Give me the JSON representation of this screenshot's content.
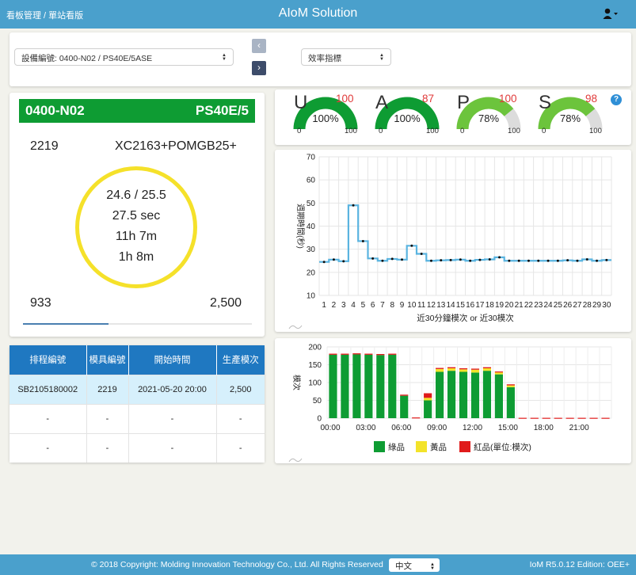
{
  "header": {
    "breadcrumb": "看板管理 / 單站看版",
    "title": "AIoM Solution",
    "user_icon": "user-icon"
  },
  "filters": {
    "device_select": "設備編號: 0400-N02 / PS40E/5ASE",
    "metric_select": "效率指標",
    "prev_icon": "chevron-left-icon",
    "next_icon": "chevron-right-icon"
  },
  "machine": {
    "id": "0400-N02",
    "model": "PS40E/5",
    "mold": "2219",
    "product": "XC2163+POMGB25+",
    "cycle_ratio": "24.6 / 25.5",
    "cycle_time": "27.5 sec",
    "run_time": "11h 7m",
    "remaining_time": "1h 8m",
    "count_done": "933",
    "count_target": "2,500",
    "progress": 0.373
  },
  "schedule": {
    "headers": [
      "排程編號",
      "模具編號",
      "開始時間",
      "生產模次"
    ],
    "rows": [
      [
        "SB2105180002",
        "2219",
        "2021-05-20 20:00",
        "2,500"
      ],
      [
        "-",
        "-",
        "-",
        "-"
      ],
      [
        "-",
        "-",
        "-",
        "-"
      ]
    ]
  },
  "gauges": [
    {
      "letter": "U",
      "target": "100",
      "value": "100%",
      "fraction": 1.0,
      "min": "0",
      "max": "100",
      "color": "#0e9c33"
    },
    {
      "letter": "A",
      "target": "87",
      "value": "100%",
      "fraction": 1.0,
      "min": "0",
      "max": "100",
      "color": "#0e9c33"
    },
    {
      "letter": "P",
      "target": "100",
      "value": "78%",
      "fraction": 0.78,
      "min": "0",
      "max": "100",
      "color": "#6cc43c"
    },
    {
      "letter": "S",
      "target": "98",
      "value": "78%",
      "fraction": 0.78,
      "min": "0",
      "max": "100",
      "color": "#6cc43c"
    }
  ],
  "help_icon": "?",
  "chart_data": [
    {
      "type": "line",
      "ylabel": "週期時間(秒)",
      "xlabel": "近30分鐘模次 or 近30模次",
      "ylim": [
        10,
        70
      ],
      "yticks": [
        "10",
        "20",
        "30",
        "40",
        "50",
        "60",
        "70"
      ],
      "x": [
        "1",
        "2",
        "3",
        "4",
        "5",
        "6",
        "7",
        "8",
        "9",
        "10",
        "11",
        "12",
        "13",
        "14",
        "15",
        "16",
        "17",
        "18",
        "19",
        "20",
        "21",
        "22",
        "23",
        "24",
        "25",
        "26",
        "27",
        "28",
        "29",
        "30"
      ],
      "values": [
        24.5,
        25.5,
        24.8,
        49,
        33.5,
        26,
        25,
        25.8,
        25.5,
        31.5,
        28,
        25,
        25.2,
        25.3,
        25.5,
        25,
        25.4,
        25.6,
        26.5,
        25,
        25,
        25,
        25,
        25,
        25,
        25.2,
        25,
        25.6,
        25,
        25.3
      ],
      "color": "#5ab4e0",
      "grid": true
    },
    {
      "type": "bar",
      "stacked": true,
      "ylabel": "模次",
      "ylim": [
        0,
        200
      ],
      "yticks": [
        "0",
        "50",
        "100",
        "150",
        "200"
      ],
      "xticks": [
        "00:00",
        "03:00",
        "06:00",
        "09:00",
        "12:00",
        "15:00",
        "18:00",
        "21:00"
      ],
      "categories": [
        "00",
        "01",
        "02",
        "03",
        "04",
        "05",
        "06",
        "07",
        "08",
        "09",
        "10",
        "11",
        "12",
        "13",
        "14",
        "15",
        "16",
        "17",
        "18",
        "19",
        "20",
        "21",
        "22",
        "23"
      ],
      "series": [
        {
          "name": "綠品",
          "color": "#0e9c33",
          "values": [
            178,
            178,
            179,
            178,
            177,
            178,
            63,
            0,
            50,
            130,
            133,
            130,
            128,
            133,
            123,
            87,
            0,
            0,
            0,
            0,
            0,
            0,
            0,
            0
          ]
        },
        {
          "name": "黃品",
          "color": "#f3e32a",
          "values": [
            0,
            0,
            0,
            0,
            0,
            0,
            0,
            0,
            7,
            8,
            7,
            7,
            8,
            7,
            6,
            5,
            0,
            0,
            0,
            0,
            0,
            0,
            0,
            0
          ]
        },
        {
          "name": "紅品(單位:模次)",
          "color": "#e01b1b",
          "values": [
            3,
            3,
            3,
            3,
            3,
            3,
            3,
            2,
            13,
            3,
            3,
            3,
            3,
            3,
            2,
            3,
            1,
            1,
            1,
            1,
            1,
            1,
            1,
            1
          ]
        }
      ]
    }
  ],
  "footer": {
    "copyright": "© 2018 Copyright: Molding Innovation Technology Co., Ltd. All Rights Reserved",
    "language": "中文",
    "version": "IoM R5.0.12 Edition: OEE+"
  }
}
